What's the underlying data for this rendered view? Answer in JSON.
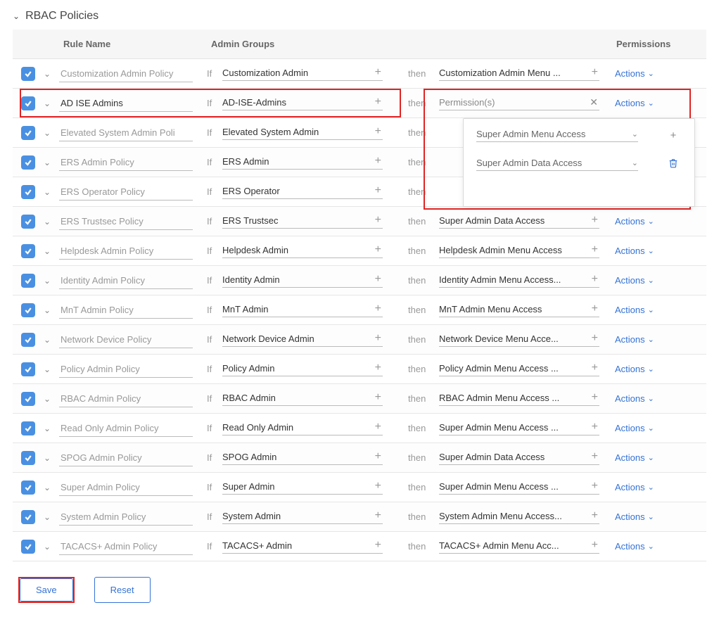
{
  "section_title": "RBAC Policies",
  "columns": {
    "rule": "Rule Name",
    "group": "Admin Groups",
    "perm": "Permissions"
  },
  "labels": {
    "if": "If",
    "then": "then",
    "actions": "Actions",
    "permissions_placeholder": "Permission(s)"
  },
  "rows": [
    {
      "checked": true,
      "rule": "Customization Admin Policy",
      "group": "Customization Admin",
      "perm": "Customization Admin Menu ..."
    },
    {
      "checked": true,
      "rule": "AD ISE Admins",
      "rule_black": true,
      "group": "AD-ISE-Admins",
      "perm": "",
      "highlighted": true,
      "perm_open": true
    },
    {
      "checked": true,
      "rule": "Elevated System Admin Poli",
      "group": "Elevated System Admin",
      "perm": ""
    },
    {
      "checked": true,
      "rule": "ERS Admin Policy",
      "group": "ERS Admin",
      "perm": ""
    },
    {
      "checked": true,
      "rule": "ERS Operator Policy",
      "group": "ERS Operator",
      "perm": ""
    },
    {
      "checked": true,
      "rule": "ERS Trustsec Policy",
      "group": "ERS Trustsec",
      "perm": "Super Admin Data Access"
    },
    {
      "checked": true,
      "rule": "Helpdesk Admin Policy",
      "group": "Helpdesk Admin",
      "perm": "Helpdesk Admin Menu Access"
    },
    {
      "checked": true,
      "rule": "Identity Admin Policy",
      "group": "Identity Admin",
      "perm": "Identity Admin Menu Access..."
    },
    {
      "checked": true,
      "rule": "MnT Admin Policy",
      "group": "MnT Admin",
      "perm": "MnT Admin Menu Access"
    },
    {
      "checked": true,
      "rule": "Network Device Policy",
      "group": "Network Device Admin",
      "perm": "Network Device Menu Acce..."
    },
    {
      "checked": true,
      "rule": "Policy Admin Policy",
      "group": "Policy Admin",
      "perm": "Policy Admin Menu Access ..."
    },
    {
      "checked": true,
      "rule": "RBAC Admin Policy",
      "group": "RBAC Admin",
      "perm": "RBAC Admin Menu Access ..."
    },
    {
      "checked": true,
      "rule": "Read Only Admin Policy",
      "group": "Read Only Admin",
      "perm": "Super Admin Menu Access ..."
    },
    {
      "checked": true,
      "rule": "SPOG Admin Policy",
      "group": "SPOG Admin",
      "perm": "Super Admin Data Access"
    },
    {
      "checked": true,
      "rule": "Super Admin Policy",
      "group": "Super Admin",
      "perm": "Super Admin Menu Access ..."
    },
    {
      "checked": true,
      "rule": "System Admin Policy",
      "group": "System Admin",
      "perm": "System Admin Menu Access..."
    },
    {
      "checked": true,
      "rule": "TACACS+ Admin Policy",
      "group": "TACACS+ Admin",
      "perm": "TACACS+ Admin Menu Acc..."
    }
  ],
  "popover": {
    "items": [
      {
        "label": "Super Admin Menu Access",
        "action": "add"
      },
      {
        "label": "Super Admin Data Access",
        "action": "delete"
      }
    ]
  },
  "footer": {
    "save": "Save",
    "reset": "Reset"
  }
}
